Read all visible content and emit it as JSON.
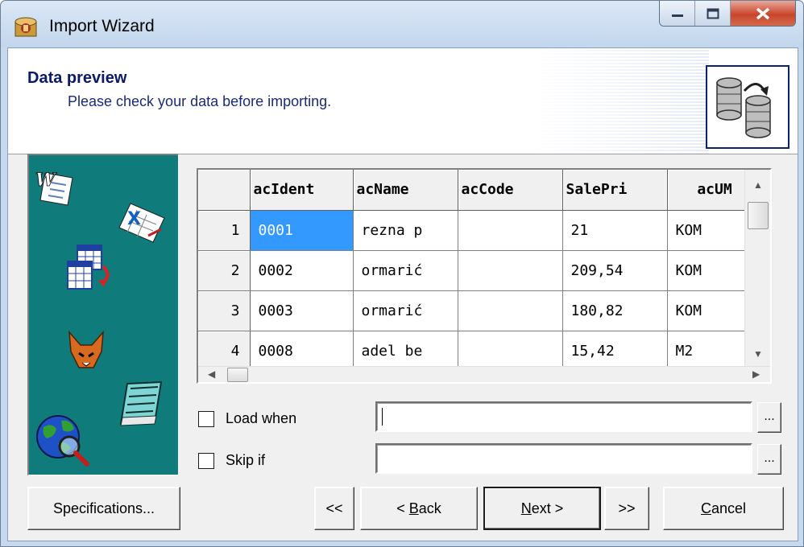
{
  "window": {
    "title": "Import Wizard"
  },
  "header": {
    "title": "Data preview",
    "subtitle": "Please check your data before importing."
  },
  "grid": {
    "columns": [
      "acIdent",
      "acName",
      "acCode",
      "SalePri",
      "acUM"
    ],
    "rows": [
      {
        "num": "1",
        "acIdent": "0001",
        "acName": "rezna p",
        "acCode": "",
        "SalePri": "21",
        "acUM": "KOM"
      },
      {
        "num": "2",
        "acIdent": "0002",
        "acName": "ormarić",
        "acCode": "",
        "SalePri": "209,54",
        "acUM": "KOM"
      },
      {
        "num": "3",
        "acIdent": "0003",
        "acName": "ormarić",
        "acCode": "",
        "SalePri": "180,82",
        "acUM": "KOM"
      },
      {
        "num": "4",
        "acIdent": "0008",
        "acName": "adel be",
        "acCode": "",
        "SalePri": "15,42",
        "acUM": "M2"
      }
    ],
    "selected_cell": "1:acIdent"
  },
  "filters": {
    "load_when": {
      "label": "Load when",
      "value": "",
      "checked": false,
      "browse_label": "..."
    },
    "skip_if": {
      "label": "Skip if",
      "value": "",
      "checked": false,
      "browse_label": "..."
    }
  },
  "buttons": {
    "specifications": "Specifications...",
    "first": "<<",
    "back_prefix": "< ",
    "back_hotkey": "B",
    "back_rest": "ack",
    "next_hotkey": "N",
    "next_rest": "ext >",
    "last": ">>",
    "cancel_hotkey": "C",
    "cancel_rest": "ancel"
  },
  "side_icons": [
    "word-document-icon",
    "excel-document-icon",
    "table-convert-icon",
    "foxpro-icon",
    "notepad-icon",
    "globe-search-icon"
  ],
  "colors": {
    "side_panel": "#0f7b7b",
    "selection": "#3399ff",
    "header_title": "#0a1a6a"
  }
}
